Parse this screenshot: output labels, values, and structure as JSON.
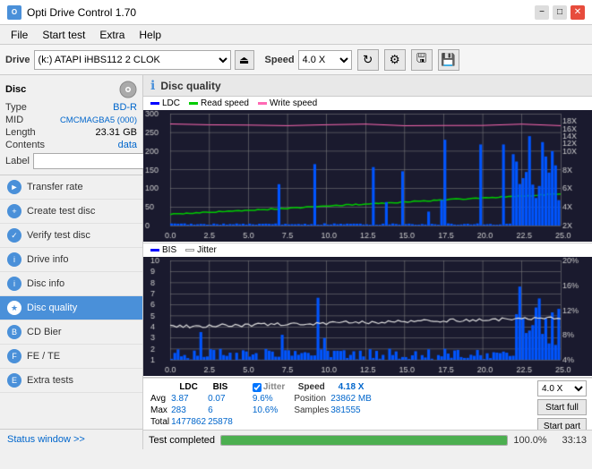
{
  "titlebar": {
    "title": "Opti Drive Control 1.70",
    "icon_label": "O",
    "min_label": "−",
    "max_label": "□",
    "close_label": "✕"
  },
  "menubar": {
    "items": [
      "File",
      "Start test",
      "Extra",
      "Help"
    ]
  },
  "drivebar": {
    "label": "Drive",
    "drive_value": "(k:)  ATAPI iHBS112  2 CLOK",
    "speed_label": "Speed",
    "speed_value": "4.0 X"
  },
  "disc": {
    "title": "Disc",
    "type_label": "Type",
    "type_value": "BD-R",
    "mid_label": "MID",
    "mid_value": "CMCMAGBA5 (000)",
    "length_label": "Length",
    "length_value": "23.31 GB",
    "contents_label": "Contents",
    "contents_value": "data",
    "label_label": "Label"
  },
  "nav": {
    "items": [
      {
        "id": "transfer-rate",
        "label": "Transfer rate",
        "active": false
      },
      {
        "id": "create-test-disc",
        "label": "Create test disc",
        "active": false
      },
      {
        "id": "verify-test-disc",
        "label": "Verify test disc",
        "active": false
      },
      {
        "id": "drive-info",
        "label": "Drive info",
        "active": false
      },
      {
        "id": "disc-info",
        "label": "Disc info",
        "active": false
      },
      {
        "id": "disc-quality",
        "label": "Disc quality",
        "active": true
      },
      {
        "id": "cd-bier",
        "label": "CD Bier",
        "active": false
      },
      {
        "id": "fe-te",
        "label": "FE / TE",
        "active": false
      },
      {
        "id": "extra-tests",
        "label": "Extra tests",
        "active": false
      }
    ]
  },
  "disc_quality": {
    "title": "Disc quality",
    "chart1_legend": {
      "ldc_label": "LDC",
      "read_label": "Read speed",
      "write_label": "Write speed"
    },
    "chart2_legend": {
      "bis_label": "BIS",
      "jitter_label": "Jitter"
    },
    "stats": {
      "ldc_header": "LDC",
      "bis_header": "BIS",
      "jitter_header": "Jitter",
      "jitter_checked": true,
      "avg_label": "Avg",
      "avg_ldc": "3.87",
      "avg_bis": "0.07",
      "avg_jitter": "9.6%",
      "max_label": "Max",
      "max_ldc": "283",
      "max_bis": "6",
      "max_jitter": "10.6%",
      "total_label": "Total",
      "total_ldc": "1477862",
      "total_bis": "25878",
      "speed_label": "Speed",
      "speed_val": "4.18 X",
      "speed_select": "4.0 X",
      "position_label": "Position",
      "position_val": "23862 MB",
      "samples_label": "Samples",
      "samples_val": "381555",
      "start_full_label": "Start full",
      "start_part_label": "Start part"
    }
  },
  "bottombar": {
    "progress_pct": "100.0%",
    "status_label": "Test completed",
    "time_val": "33:13"
  },
  "status_window": {
    "label": "Status window >>"
  }
}
